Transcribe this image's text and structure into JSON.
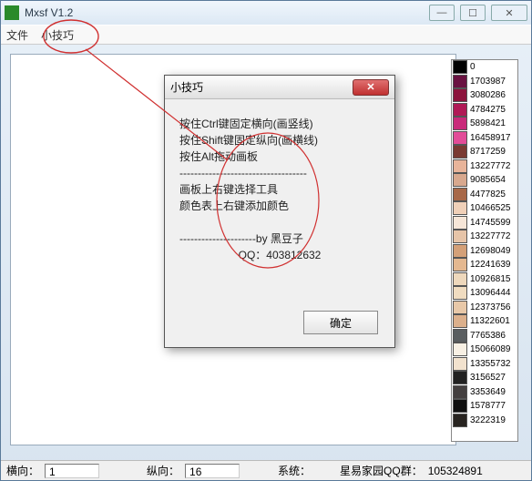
{
  "window": {
    "title": "Mxsf V1.2"
  },
  "menu": {
    "file": "文件",
    "tips": "小技巧"
  },
  "dialog": {
    "title": "小技巧",
    "line1": "按住Ctrl键固定横向(画竖线)",
    "line2": "按住Shift键固定纵向(画横线)",
    "line3": "按住Alt拖动画板",
    "sep": "-----------------------------------",
    "line4": "画板上右键选择工具",
    "line5": "颜色表上右键添加颜色",
    "line6": "---------------------by 黑豆子",
    "line7": "QQ：403812632",
    "ok": "确定"
  },
  "palette": [
    {
      "c": "#000000",
      "v": "0"
    },
    {
      "c": "#6a1241",
      "v": "1703987"
    },
    {
      "c": "#8c133c",
      "v": "3080286"
    },
    {
      "c": "#b01a56",
      "v": "4784275"
    },
    {
      "c": "#c92a7a",
      "v": "5898421"
    },
    {
      "c": "#e24c98",
      "v": "16458917"
    },
    {
      "c": "#7a3a32",
      "v": "8717259"
    },
    {
      "c": "#e8b49a",
      "v": "13227772"
    },
    {
      "c": "#d8a88e",
      "v": "9085654"
    },
    {
      "c": "#a86848",
      "v": "4477825"
    },
    {
      "c": "#f0d0b8",
      "v": "10466525"
    },
    {
      "c": "#f6e6d8",
      "v": "14745599"
    },
    {
      "c": "#e6c4a8",
      "v": "13227772"
    },
    {
      "c": "#d4a078",
      "v": "12698049"
    },
    {
      "c": "#e4b890",
      "v": "12241639"
    },
    {
      "c": "#eed8bc",
      "v": "10926815"
    },
    {
      "c": "#f0dcc0",
      "v": "13096444"
    },
    {
      "c": "#e8c8a8",
      "v": "12373756"
    },
    {
      "c": "#dcb08c",
      "v": "11322601"
    },
    {
      "c": "#5a5e60",
      "v": "7765386"
    },
    {
      "c": "#f8f0e4",
      "v": "15066089"
    },
    {
      "c": "#f2e2ce",
      "v": "13355732"
    },
    {
      "c": "#222222",
      "v": "3156527"
    },
    {
      "c": "#444040",
      "v": "3353649"
    },
    {
      "c": "#101010",
      "v": "1578777"
    },
    {
      "c": "#282420",
      "v": "3222319"
    }
  ],
  "status": {
    "h_label": "横向：",
    "h_val": "1",
    "v_label": "纵向：",
    "v_val": "16",
    "sys_label": "系统：",
    "group_label": "星易家园QQ群：",
    "group_val": "105324891"
  },
  "annot": {
    "circle_color": "#d03030"
  }
}
